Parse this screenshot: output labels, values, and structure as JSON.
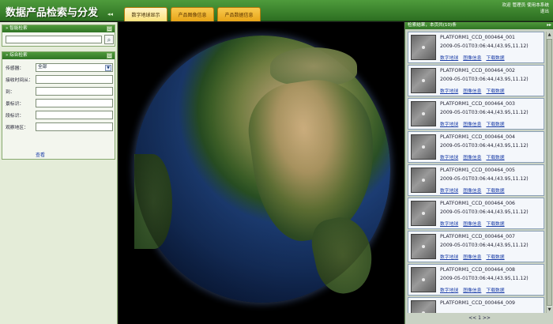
{
  "app": {
    "title": "数据产品检索与分发",
    "collapse_left": "◂◂"
  },
  "tabs": [
    {
      "label": "数字地球显示",
      "active": true
    },
    {
      "label": "产品图像信息",
      "active": false
    },
    {
      "label": "产品数据信息",
      "active": false
    }
  ],
  "user": {
    "welcome": "欢迎",
    "name": "管理员",
    "help": "使用本系统",
    "logout": "退出"
  },
  "quick_search": {
    "title": "» 智能检索",
    "toggle": "⊟",
    "value": "",
    "search_icon": "magnifier-icon"
  },
  "combo_search": {
    "title": "» 综合检索",
    "toggle": "⊟",
    "fields": {
      "sensor": {
        "label": "传感器：",
        "value": "全部"
      },
      "start_time": {
        "label": "接收时间从：",
        "value": ""
      },
      "end_time": {
        "label": "到：",
        "value": ""
      },
      "path": {
        "label": "景标识：",
        "value": ""
      },
      "row": {
        "label": "段标识：",
        "value": ""
      },
      "region": {
        "label": "观察地区：",
        "value": ""
      }
    },
    "query_label": "查看"
  },
  "results": {
    "header": "检索结果，本页共(10)条",
    "collapse_right": "▸▸",
    "link_globe": "数字地球",
    "link_image": "图像信息",
    "link_download": "下载数据",
    "items": [
      {
        "title": "PLATFORM1_CCD_000464_001",
        "time": "2009-05-01T03:06:44,(43.95,11.12)"
      },
      {
        "title": "PLATFORM1_CCD_000464_002",
        "time": "2009-05-01T03:06:44,(43.95,11.12)"
      },
      {
        "title": "PLATFORM1_CCD_000464_003",
        "time": "2009-05-01T03:06:44,(43.95,11.12)"
      },
      {
        "title": "PLATFORM1_CCD_000464_004",
        "time": "2009-05-01T03:06:44,(43.95,11.12)"
      },
      {
        "title": "PLATFORM1_CCD_000464_005",
        "time": "2009-05-01T03:06:44,(43.95,11.12)"
      },
      {
        "title": "PLATFORM1_CCD_000464_006",
        "time": "2009-05-01T03:06:44,(43.95,11.12)"
      },
      {
        "title": "PLATFORM1_CCD_000464_007",
        "time": "2009-05-01T03:06:44,(43.95,11.12)"
      },
      {
        "title": "PLATFORM1_CCD_000464_008",
        "time": "2009-05-01T03:06:44,(43.95,11.12)"
      },
      {
        "title": "PLATFORM1_CCD_000464_009",
        "time": ""
      }
    ],
    "pager": {
      "prev": "<<",
      "page": "1",
      "next": ">>"
    }
  },
  "colors": {
    "header_green": "#3f8a30",
    "tab_orange": "#f2b431",
    "active_tab": "#fde68a",
    "link_blue": "#1b3ea8",
    "panel_bg": "#e4ecd8"
  }
}
